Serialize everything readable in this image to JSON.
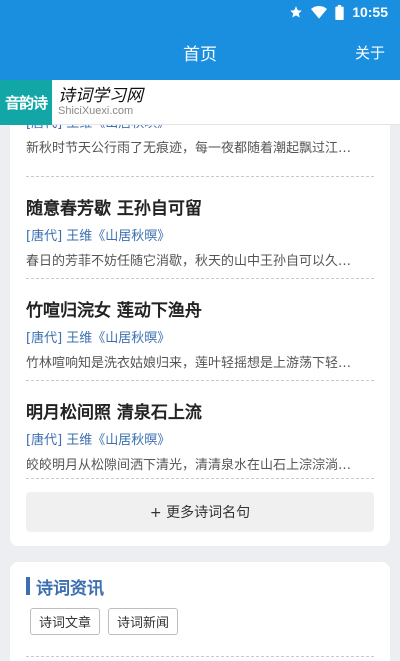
{
  "status_bar": {
    "time": "10:55",
    "icons": [
      "star-icon",
      "wifi-icon",
      "battery-icon"
    ]
  },
  "app_bar": {
    "title": "首页",
    "about_label": "关于"
  },
  "logo": {
    "mark_text": "音韵诗",
    "name": "诗词学习网",
    "domain": "ShiciXuexi.com"
  },
  "quotes": [
    {
      "title": "",
      "source": "[唐代] 王维《山居秋暝》",
      "desc": "新秋时节天公行雨了无痕迹，每一夜都随着潮起飘过江…"
    },
    {
      "title": "随意春芳歇 王孙自可留",
      "source": "[唐代] 王维《山居秋暝》",
      "desc": "春日的芳菲不妨任随它消歇，秋天的山中王孙自可以久…"
    },
    {
      "title": "竹喧归浣女 莲动下渔舟",
      "source": "[唐代] 王维《山居秋暝》",
      "desc": "竹林喧响知是洗衣姑娘归来，莲叶轻摇想是上游荡下轻…"
    },
    {
      "title": "明月松间照 清泉石上流",
      "source": "[唐代] 王维《山居秋暝》",
      "desc": "皎皎明月从松隙间洒下清光，清清泉水在山石上淙淙淌…"
    }
  ],
  "more_button_label": "+ 更多诗词名句",
  "news_section": {
    "title": "诗词资讯",
    "tags": [
      "诗词文章",
      "诗词新闻"
    ]
  },
  "colors": {
    "primary": "#1a8fe0",
    "accent_text": "#3b6fb0",
    "logo_teal": "#12a6a6",
    "background": "#eceef1"
  }
}
